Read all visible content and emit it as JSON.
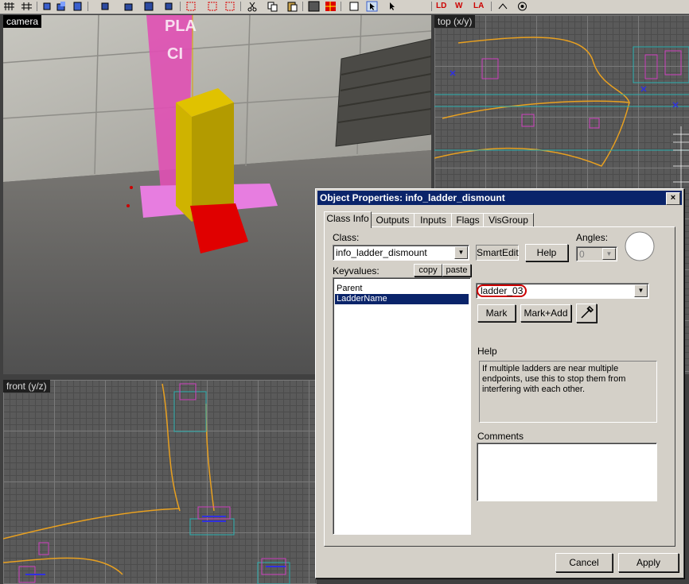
{
  "toolbar": {
    "icons": [
      "grid-icon",
      "grid-icon",
      "cube-icon",
      "cube-icon",
      "cube-icon",
      "cube-icon",
      "selection-icon",
      "selection-icon",
      "cut-icon",
      "copy-icon",
      "paste-icon",
      "texture-icon",
      "texture-icon",
      "texture-icon",
      "cursor-icon",
      "cursor-icon",
      "ld-icon",
      "w-icon",
      "la-icon",
      "gear-icon",
      "gear-icon"
    ],
    "ld_label": "LD",
    "w_label": "W",
    "la_label": "LA"
  },
  "viewports": {
    "camera_label": "camera",
    "top_label": "top (x/y)",
    "front_label": "front (y/z)",
    "sign_text_1": "PLA",
    "sign_text_2": "CI"
  },
  "dialog": {
    "title": "Object Properties: info_ladder_dismount",
    "close_glyph": "×",
    "tabs": [
      "Class Info",
      "Outputs",
      "Inputs",
      "Flags",
      "VisGroup"
    ],
    "active_tab": 0,
    "class_label": "Class:",
    "class_value": "info_ladder_dismount",
    "smartedit_label": "SmartEdit",
    "help_button_label": "Help",
    "angles_label": "Angles:",
    "angles_value": "0",
    "keyvalues_label": "Keyvalues:",
    "copy_label": "copy",
    "paste_label": "paste",
    "keyvalues": [
      "Parent",
      "LadderName"
    ],
    "selected_keyvalue": 1,
    "value_field": "ladder_03",
    "mark_label": "Mark",
    "mark_add_label": "Mark+Add",
    "eyedropper_icon": "eyedropper-icon",
    "help_section_label": "Help",
    "help_text": "If multiple ladders are near multiple endpoints, use this to stop them from interfering with each other.",
    "comments_label": "Comments",
    "comments_value": "",
    "cancel_label": "Cancel",
    "apply_label": "Apply",
    "highlight_color": "#cc0000"
  }
}
